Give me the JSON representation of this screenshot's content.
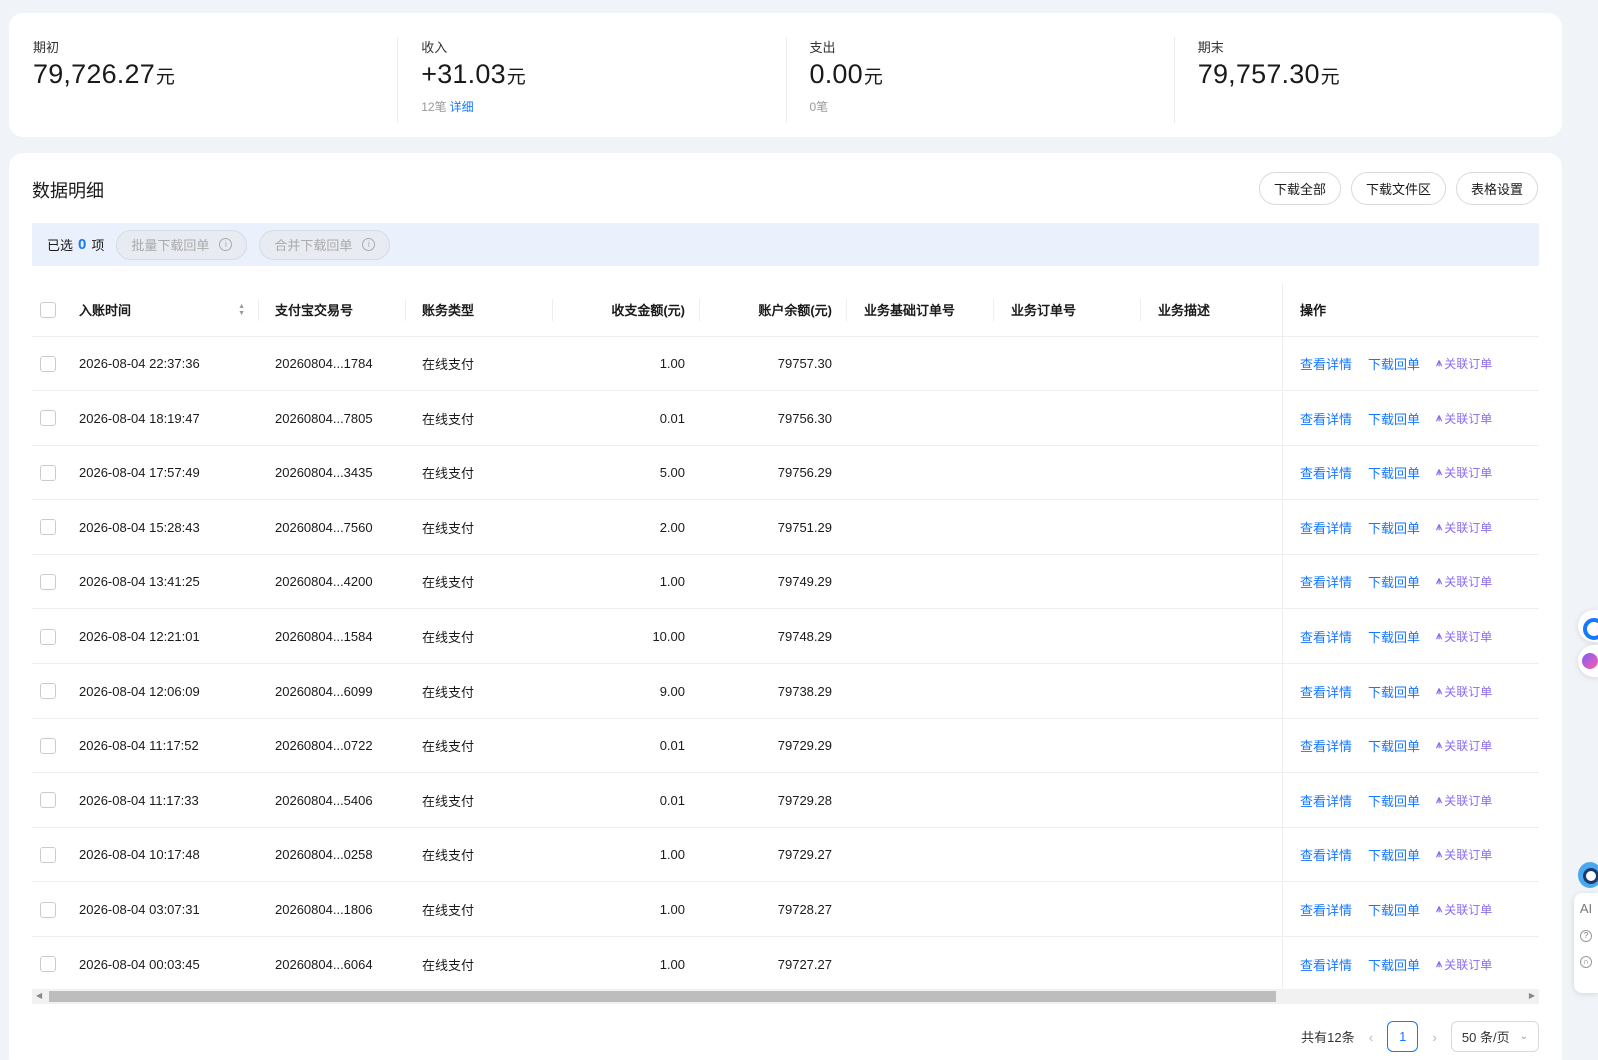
{
  "summary": [
    {
      "label": "期初",
      "value": "79,726.27",
      "unit": "元",
      "sub_count": "",
      "sub_link": ""
    },
    {
      "label": "收入",
      "value": "+31.03",
      "unit": "元",
      "sub_count": "12笔",
      "sub_link": "详细"
    },
    {
      "label": "支出",
      "value": "0.00",
      "unit": "元",
      "sub_count": "0笔",
      "sub_link": ""
    },
    {
      "label": "期末",
      "value": "79,757.30",
      "unit": "元",
      "sub_count": "",
      "sub_link": ""
    }
  ],
  "main": {
    "title": "数据明细",
    "buttons": [
      "下载全部",
      "下载文件区",
      "表格设置"
    ]
  },
  "selection": {
    "prefix": "已选",
    "count": "0",
    "suffix": "项",
    "batch_download": "批量下载回单",
    "merge_download": "合并下载回单"
  },
  "table": {
    "headers": {
      "time": "入账时间",
      "trade_no": "支付宝交易号",
      "type": "账务类型",
      "amount": "收支金额(元)",
      "balance": "账户余额(元)",
      "base_order": "业务基础订单号",
      "order": "业务订单号",
      "desc": "业务描述",
      "ops": "操作"
    },
    "op_labels": {
      "detail": "查看详情",
      "download": "下载回单",
      "associate": "关联订单"
    },
    "rows": [
      {
        "time": "2026-08-04 22:37:36",
        "trade_no": "20260804...1784",
        "type": "在线支付",
        "amount": "1.00",
        "balance": "79757.30"
      },
      {
        "time": "2026-08-04 18:19:47",
        "trade_no": "20260804...7805",
        "type": "在线支付",
        "amount": "0.01",
        "balance": "79756.30"
      },
      {
        "time": "2026-08-04 17:57:49",
        "trade_no": "20260804...3435",
        "type": "在线支付",
        "amount": "5.00",
        "balance": "79756.29"
      },
      {
        "time": "2026-08-04 15:28:43",
        "trade_no": "20260804...7560",
        "type": "在线支付",
        "amount": "2.00",
        "balance": "79751.29"
      },
      {
        "time": "2026-08-04 13:41:25",
        "trade_no": "20260804...4200",
        "type": "在线支付",
        "amount": "1.00",
        "balance": "79749.29"
      },
      {
        "time": "2026-08-04 12:21:01",
        "trade_no": "20260804...1584",
        "type": "在线支付",
        "amount": "10.00",
        "balance": "79748.29"
      },
      {
        "time": "2026-08-04 12:06:09",
        "trade_no": "20260804...6099",
        "type": "在线支付",
        "amount": "9.00",
        "balance": "79738.29"
      },
      {
        "time": "2026-08-04 11:17:52",
        "trade_no": "20260804...0722",
        "type": "在线支付",
        "amount": "0.01",
        "balance": "79729.29"
      },
      {
        "time": "2026-08-04 11:17:33",
        "trade_no": "20260804...5406",
        "type": "在线支付",
        "amount": "0.01",
        "balance": "79729.28"
      },
      {
        "time": "2026-08-04 10:17:48",
        "trade_no": "20260804...0258",
        "type": "在线支付",
        "amount": "1.00",
        "balance": "79729.27"
      },
      {
        "time": "2026-08-04 03:07:31",
        "trade_no": "20260804...1806",
        "type": "在线支付",
        "amount": "1.00",
        "balance": "79728.27"
      },
      {
        "time": "2026-08-04 00:03:45",
        "trade_no": "20260804...6064",
        "type": "在线支付",
        "amount": "1.00",
        "balance": "79727.27"
      }
    ]
  },
  "pagination": {
    "total": "共有12条",
    "current": "1",
    "page_size": "50 条/页"
  },
  "widgets": {
    "ai_label": "AI"
  },
  "icons": {
    "sort": "sort-icon",
    "info": "info-icon",
    "chevron_left": "chevron-left-icon",
    "chevron_right": "chevron-right-icon",
    "chevron_down": "chevron-down-icon"
  },
  "colors": {
    "accent": "#1677ff",
    "associate": "#8c6cf0",
    "selection_bar": "#ebf1fc"
  }
}
